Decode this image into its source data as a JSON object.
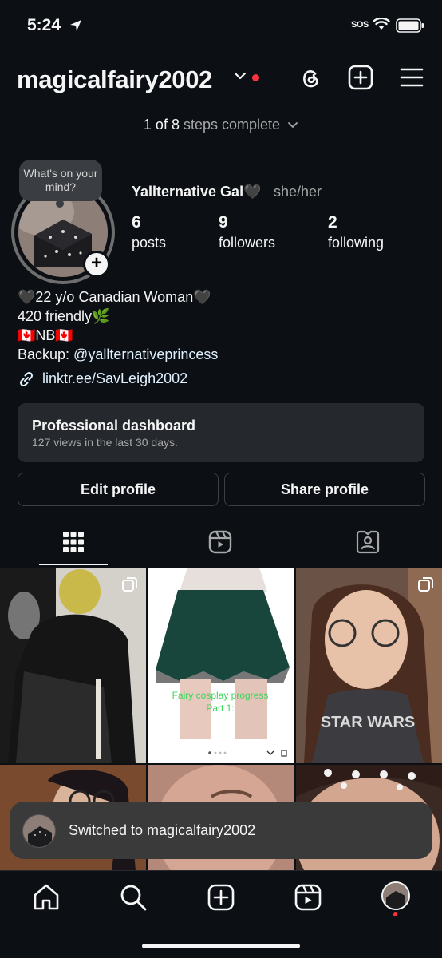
{
  "status_bar": {
    "time": "5:24",
    "carrier": "SOS"
  },
  "header": {
    "username": "magicalfairy2002"
  },
  "steps": {
    "progress": "1 of 8",
    "label": "steps complete"
  },
  "profile": {
    "bubble_text": "What's on your mind?",
    "display_name": "Yallternative Gal🖤",
    "pronouns": "she/her",
    "stats": [
      {
        "value": "6",
        "label": "posts"
      },
      {
        "value": "9",
        "label": "followers"
      },
      {
        "value": "2",
        "label": "following"
      }
    ]
  },
  "bio": {
    "line1": "🖤22 y/o Canadian Woman🖤",
    "line2": "420 friendly🌿",
    "line3": "🇨🇦NB🇨🇦",
    "backup_prefix": "Backup: ",
    "backup_handle": "@yallternativeprincess",
    "link": "linktr.ee/SavLeigh2002"
  },
  "dashboard": {
    "title": "Professional dashboard",
    "subtitle": "127 views in the last 30 days."
  },
  "buttons": {
    "edit": "Edit profile",
    "share": "Share profile"
  },
  "tabs": [
    "grid",
    "reels",
    "tagged"
  ],
  "grid_posts": [
    {
      "overlay": "",
      "type": "carousel"
    },
    {
      "overlay": "Fairy cosplay progress\nPart 1:",
      "type": "reel"
    },
    {
      "overlay": "",
      "type": "carousel"
    },
    {
      "overlay": "",
      "type": "photo"
    },
    {
      "overlay": "",
      "type": "photo"
    },
    {
      "overlay": "",
      "type": "photo"
    }
  ],
  "toast": {
    "message": "Switched to magicalfairy2002"
  },
  "colors": {
    "background": "#0c1014",
    "notification": "#ff3040",
    "link": "#e0f1ff",
    "muted": "#a8a8a8"
  }
}
